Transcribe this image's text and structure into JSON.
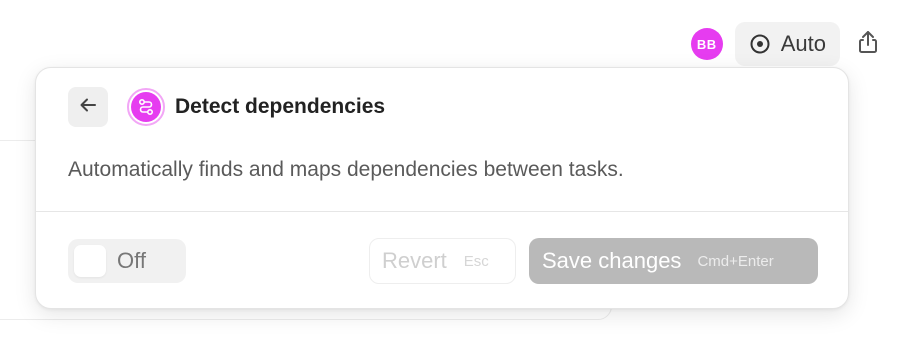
{
  "toolbar": {
    "avatar_initials": "BB",
    "auto_label": "Auto",
    "auto_icon": "radio-target-icon",
    "share_icon": "share-icon"
  },
  "popover": {
    "back_icon": "arrow-left-icon",
    "feature_icon": "dependency-path-icon",
    "title": "Detect dependencies",
    "description": "Automatically finds and maps dependencies between tasks.",
    "toggle": {
      "state": "off",
      "label": "Off"
    },
    "revert": {
      "label": "Revert",
      "shortcut": "Esc",
      "enabled": false
    },
    "save": {
      "label": "Save changes",
      "shortcut": "Cmd+Enter",
      "enabled": false
    }
  },
  "colors": {
    "accent": "#e63cf0",
    "save_disabled_bg": "#b9b9b9",
    "toggle_bg": "#f1f1f1"
  }
}
